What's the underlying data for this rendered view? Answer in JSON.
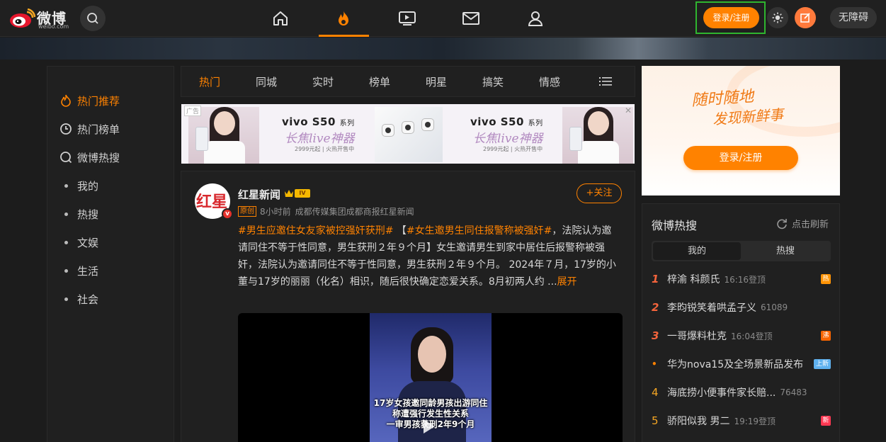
{
  "header": {
    "logo_text": "微博",
    "logo_sub": "weibo.com",
    "login_label": "登录/注册",
    "a11y_label": "无障碍",
    "nav": [
      "home-icon",
      "hot-flame-icon",
      "video-icon",
      "message-icon",
      "profile-icon"
    ],
    "accent": "#ff8200"
  },
  "sidebar": {
    "items": [
      {
        "label": "热门推荐",
        "icon": "flame-icon"
      },
      {
        "label": "热门榜单",
        "icon": "clock-icon"
      },
      {
        "label": "微博热搜",
        "icon": "search-icon"
      },
      {
        "label": "我的"
      },
      {
        "label": "热搜"
      },
      {
        "label": "文娱"
      },
      {
        "label": "生活"
      },
      {
        "label": "社会"
      }
    ]
  },
  "tabs": [
    "热门",
    "同城",
    "实时",
    "榜单",
    "明星",
    "搞笑",
    "情感"
  ],
  "ad": {
    "tag": "广告",
    "brand": "vivo S50",
    "series": "系列",
    "slogan": "长焦live神器",
    "price": "2999元起 | 火热开售中"
  },
  "post": {
    "author": "红星新闻",
    "level": "IV",
    "follow_label": "+关注",
    "orig_tag": "原创",
    "time": "8小时前",
    "source": "成都传媒集团成都商报红星新闻",
    "tag1": "#男生应邀住女友家被控强奸获刑#",
    "tag2": "#女生邀男生同住报警称被强奸#",
    "body_start": " 【",
    "body": "，法院认为邀请同住不等于性同意，男生获刑２年９个月】女生邀请男生到家中居住后报警称被强奸，法院认为邀请同住不等于性同意，男生获刑２年９个月。 2024年７月，17岁的小董与17岁的丽丽（化名）相识，随后很快确定恋爱关系。8月初两人约 ...",
    "more": "展开",
    "video_caption": [
      "17岁女孩邀同龄男孩出游同住",
      "称遭强行发生性关系",
      "一审男孩获刑2年9个月"
    ]
  },
  "promo": {
    "line1": "随时随地",
    "line2": "发现新鲜事",
    "button": "登录/注册"
  },
  "hot": {
    "title": "微博热搜",
    "refresh": "点击刷新",
    "tabs": [
      "我的",
      "热搜"
    ],
    "rows": [
      {
        "rank": "1",
        "text": "梓渝 科颜氏",
        "extra": "16:16登顶",
        "badge": "热",
        "badge_color": "#ff9406"
      },
      {
        "rank": "2",
        "text": "李昀锐笑着哄孟子义",
        "extra": "61089",
        "badge": ""
      },
      {
        "rank": "3",
        "text": "一哥爆料杜克",
        "extra": "16:04登顶",
        "badge": "沸",
        "badge_color": "#f86400"
      },
      {
        "rank": "•",
        "text": "华为nova15及全场景新品发布",
        "extra": "",
        "badge": "上新",
        "badge_color": "#5fb1ef"
      },
      {
        "rank": "4",
        "text": "海底捞小便事件家长赔...",
        "extra": "76483",
        "badge": ""
      },
      {
        "rank": "5",
        "text": "骄阳似我 男二",
        "extra": "19:19登顶",
        "badge": "新",
        "badge_color": "#ff3852"
      }
    ]
  }
}
